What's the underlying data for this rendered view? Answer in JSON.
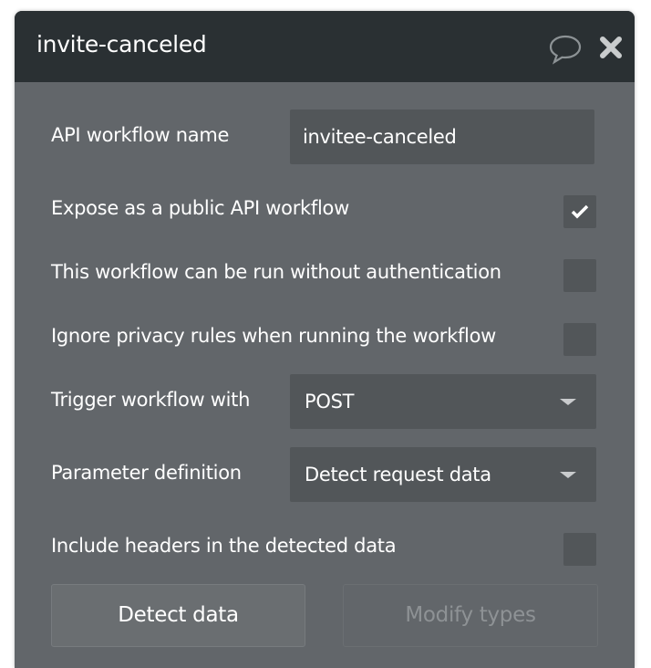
{
  "header": {
    "title": "invite-canceled",
    "comment_icon": "speech-bubble-icon",
    "close_icon": "close-x-icon"
  },
  "form": {
    "name_label": "API workflow name",
    "name_value": "invitee-canceled",
    "expose_label": "Expose as a public API workflow",
    "expose_checked": true,
    "no_auth_label": "This workflow can be run without authentication",
    "no_auth_checked": false,
    "ignore_privacy_label": "Ignore privacy rules when running the workflow",
    "ignore_privacy_checked": false,
    "trigger_label": "Trigger workflow with",
    "trigger_value": "POST",
    "param_label": "Parameter definition",
    "param_value": "Detect request data",
    "headers_label": "Include headers in the detected data",
    "headers_checked": false
  },
  "buttons": {
    "detect": "Detect data",
    "modify": "Modify types"
  },
  "colors": {
    "header": "#2a3033",
    "panel": "#62666a",
    "field": "#525659"
  }
}
